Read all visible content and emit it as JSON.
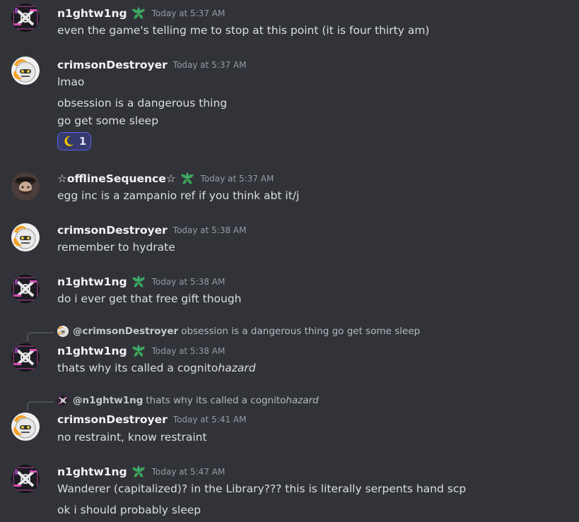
{
  "messages": [
    {
      "id": "m1",
      "user": "n1ghtw1ng",
      "has_role_icon": true,
      "timestamp": "Today at 5:37 AM",
      "lines": [
        "even the game's telling me to stop at this point (it is four thirty am)"
      ]
    },
    {
      "id": "m2",
      "user": "crimsonDestroyer",
      "has_role_icon": false,
      "timestamp": "Today at 5:37 AM",
      "lines": [
        "lmao",
        "obsession is a dangerous thing",
        "go get some sleep"
      ],
      "reaction": {
        "emoji": "☾",
        "count": "1"
      }
    },
    {
      "id": "m3",
      "user": "☆offlineSequence☆",
      "has_role_icon": true,
      "timestamp": "Today at 5:37 AM",
      "lines": [
        "egg inc is a zampanio ref if you think abt it/j"
      ]
    },
    {
      "id": "m4",
      "user": "crimsonDestroyer",
      "has_role_icon": false,
      "timestamp": "Today at 5:38 AM",
      "lines": [
        "remember to hydrate"
      ]
    },
    {
      "id": "m5",
      "user": "n1ghtw1ng",
      "has_role_icon": true,
      "timestamp": "Today at 5:38 AM",
      "lines": [
        "do i ever get that free gift though"
      ]
    },
    {
      "id": "m6",
      "user": "n1ghtw1ng",
      "has_role_icon": true,
      "timestamp": "Today at 5:38 AM",
      "reply": {
        "user": "@crimsonDestroyer",
        "text": "obsession is a dangerous thing go get some sleep"
      },
      "lines": [
        "thats why its called a cognito"
      ],
      "italic_suffix": "hazard"
    },
    {
      "id": "m7",
      "user": "crimsonDestroyer",
      "has_role_icon": false,
      "timestamp": "Today at 5:41 AM",
      "reply": {
        "user": "@n1ghtw1ng",
        "text": "thats why its called a cognito",
        "italic_suffix": "hazard"
      },
      "lines": [
        "no restraint, know restraint"
      ]
    },
    {
      "id": "m8",
      "user": "n1ghtw1ng",
      "has_role_icon": true,
      "timestamp": "Today at 5:47 AM",
      "lines": [
        "Wanderer (capitalized)? in the Library??? this is literally serpents hand scp",
        "ok i should probably sleep"
      ]
    }
  ],
  "colors": {
    "background": "#313338",
    "username": "#f2f3f5",
    "text": "#dbdee1",
    "timestamp": "#949ba4",
    "role_icon": "#3ba55c",
    "reaction_border": "#5865f2",
    "reaction_bg": "#373a6c"
  },
  "icons": {
    "role": "sprout-role-icon",
    "reaction": "crescent-moon-emoji"
  }
}
